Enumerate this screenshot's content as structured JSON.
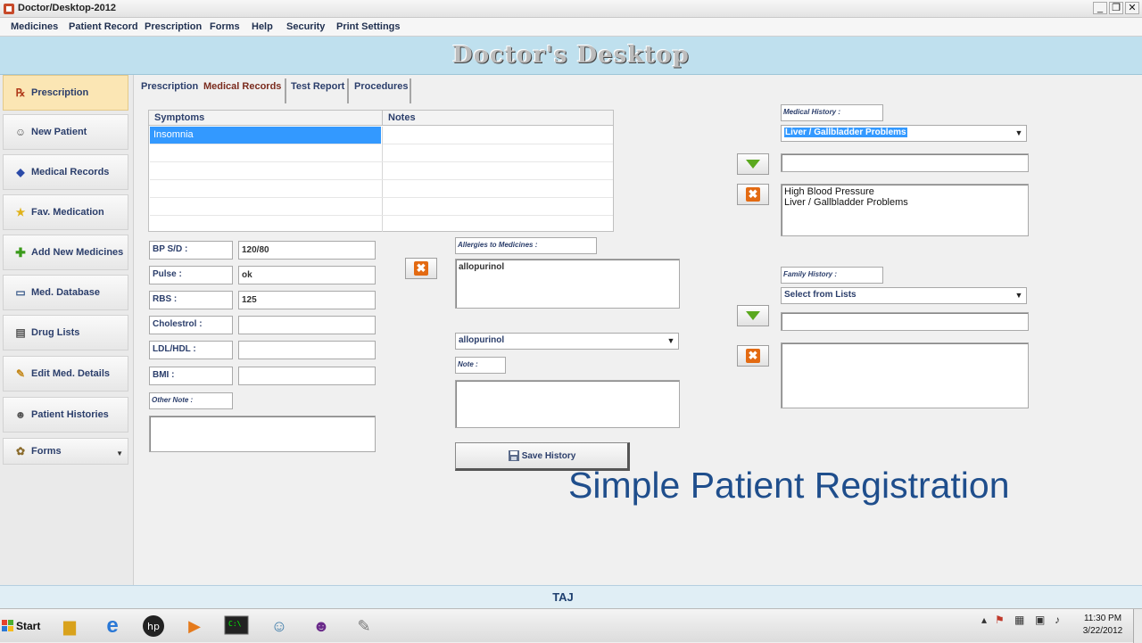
{
  "window": {
    "title": "Doctor/Desktop-2012",
    "controls": {
      "minimize": "_",
      "restore": "❐",
      "close": "✕"
    }
  },
  "menu": [
    "Medicines",
    "Patient Record",
    "Prescription",
    "Forms",
    "Help",
    "Security",
    "Print Settings"
  ],
  "header": {
    "title": "Doctor's Desktop"
  },
  "sidebar": {
    "items": [
      {
        "label": "Prescription",
        "icon": "rx-icon"
      },
      {
        "label": "New Patient",
        "icon": "patient-icon"
      },
      {
        "label": "Medical Records",
        "icon": "records-icon"
      },
      {
        "label": "Fav. Medication",
        "icon": "star-icon"
      },
      {
        "label": "Add New Medicines",
        "icon": "plus-icon"
      },
      {
        "label": "Med. Database",
        "icon": "monitor-icon"
      },
      {
        "label": "Drug Lists",
        "icon": "list-icon"
      },
      {
        "label": "Edit Med. Details",
        "icon": "pencil-icon"
      },
      {
        "label": "Patient Histories",
        "icon": "person-icon"
      },
      {
        "label": "Forms",
        "icon": "forms-icon"
      }
    ]
  },
  "tabs": [
    "Prescription",
    "Medical Records",
    "Test Report",
    "Procedures"
  ],
  "symptoms_grid": {
    "columns": [
      "Symptoms",
      "Notes"
    ],
    "rows": [
      [
        "Insomnia",
        ""
      ]
    ]
  },
  "vitals": [
    {
      "label": "BP S/D :",
      "value": "120/80"
    },
    {
      "label": "Pulse :",
      "value": "ok"
    },
    {
      "label": "RBS :",
      "value": "125"
    },
    {
      "label": "Cholestrol :",
      "value": ""
    },
    {
      "label": "LDL/HDL :",
      "value": ""
    },
    {
      "label": "BMI :",
      "value": ""
    }
  ],
  "other_note": {
    "label": "Other Note :",
    "value": ""
  },
  "allergies": {
    "label": "Allergies to Medicines :",
    "list_value": "allopurinol",
    "select_value": "allopurinol",
    "note_label": "Note :"
  },
  "medical_history": {
    "label": "Medical History :",
    "select_value": "Liver / Gallbladder Problems",
    "entry_value": "",
    "list": [
      "High Blood Pressure",
      "Liver / Gallbladder Problems"
    ]
  },
  "family_history": {
    "label": "Family History :",
    "select_value": "Select from Lists",
    "entry_value": ""
  },
  "save_button": {
    "label": "Save History"
  },
  "caption": "Simple Patient Registration",
  "status": {
    "text": "TAJ"
  },
  "taskbar": {
    "start_label": "Start",
    "time": "11:30 PM",
    "date": "3/22/2012"
  },
  "colors": {
    "header_band": "#bfe0ee",
    "selection": "#3399ff",
    "active_sidebar": "#fbe6b4",
    "caption_text": "#1f4e8c",
    "delete_icon": "#e36a12",
    "add_icon": "#5aa81e"
  }
}
